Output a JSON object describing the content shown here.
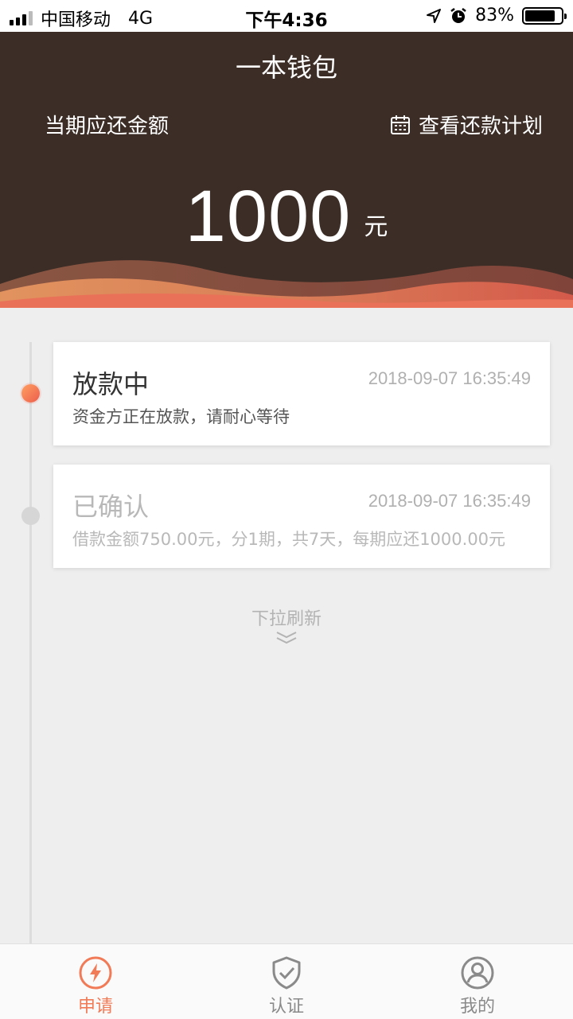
{
  "status_bar": {
    "carrier": "中国移动",
    "network": "4G",
    "time": "下午4:36",
    "battery": "83%",
    "battery_level": 0.83
  },
  "header": {
    "title": "一本钱包",
    "due_label": "当期应还金额",
    "plan_link": "查看还款计划",
    "amount": "1000",
    "unit": "元"
  },
  "timeline": [
    {
      "title": "放款中",
      "time": "2018-09-07 16:35:49",
      "desc": "资金方正在放款，请耐心等待",
      "active": true
    },
    {
      "title": "已确认",
      "time": "2018-09-07 16:35:49",
      "desc": "借款金额750.00元，分1期，共7天，每期应还1000.00元",
      "active": false
    }
  ],
  "pull_hint": "下拉刷新",
  "tabs": [
    {
      "label": "申请",
      "icon": "lightning-icon",
      "active": true
    },
    {
      "label": "认证",
      "icon": "shield-check-icon",
      "active": false
    },
    {
      "label": "我的",
      "icon": "user-icon",
      "active": false
    }
  ],
  "colors": {
    "header_bg": "#3c2d26",
    "accent": "#f17a57",
    "page_bg": "#eeeeee"
  }
}
